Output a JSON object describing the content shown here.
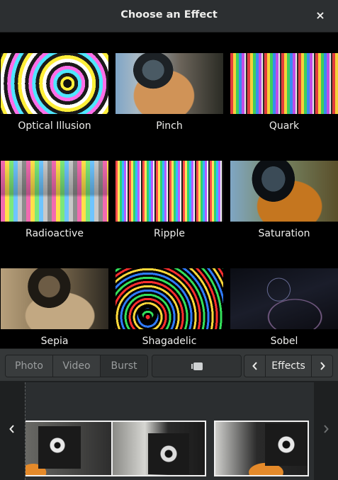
{
  "window": {
    "title": "Choose an Effect",
    "close_glyph": "×"
  },
  "effects": [
    {
      "label": "Optical Illusion"
    },
    {
      "label": "Pinch"
    },
    {
      "label": "Quark"
    },
    {
      "label": "Radioactive"
    },
    {
      "label": "Ripple"
    },
    {
      "label": "Saturation"
    },
    {
      "label": "Sepia"
    },
    {
      "label": "Shagadelic"
    },
    {
      "label": "Sobel"
    }
  ],
  "toolbar": {
    "modes": [
      "Photo",
      "Video",
      "Burst"
    ],
    "effects_label": "Effects",
    "icons": {
      "shoot": "camera-icon",
      "prev": "chevron-left-icon",
      "next": "chevron-right-icon"
    }
  },
  "strip": {
    "icons": {
      "prev": "chevron-left-icon",
      "next": "chevron-right-icon"
    }
  }
}
